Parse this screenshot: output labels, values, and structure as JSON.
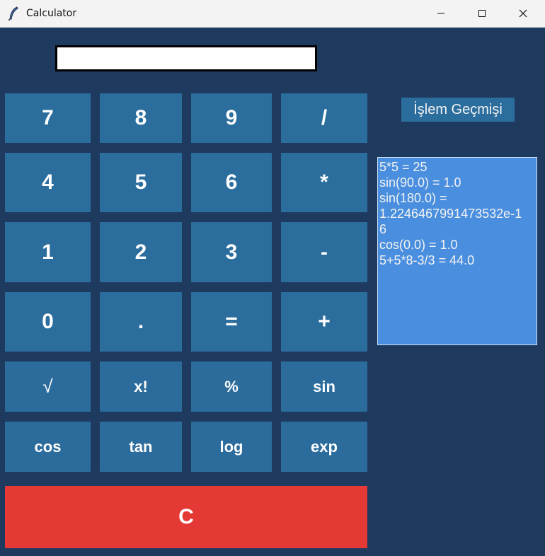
{
  "window": {
    "title": "Calculator",
    "background": "#1f3a5f"
  },
  "display": {
    "value": ""
  },
  "keypad": {
    "rows": [
      [
        "7",
        "8",
        "9",
        "/"
      ],
      [
        "4",
        "5",
        "6",
        "*"
      ],
      [
        "1",
        "2",
        "3",
        "-"
      ],
      [
        "0",
        ".",
        "=",
        "+"
      ],
      [
        "√",
        "x!",
        "%",
        "sin"
      ],
      [
        "cos",
        "tan",
        "log",
        "exp"
      ]
    ],
    "clear_label": "C",
    "key_color": "#2b6e9e",
    "clear_color": "#e53935"
  },
  "history": {
    "title": "İşlem Geçmişi",
    "lines": [
      "5*5 = 25",
      "sin(90.0) = 1.0",
      "sin(180.0) =",
      "1.2246467991473532e-1",
      "6",
      "cos(0.0) = 1.0",
      "5+5*8-3/3 = 44.0"
    ],
    "box_color": "#4a8fdf"
  },
  "icons": {
    "app": "feather-icon",
    "minimize": "minimize-icon",
    "maximize": "maximize-icon",
    "close": "close-icon"
  }
}
